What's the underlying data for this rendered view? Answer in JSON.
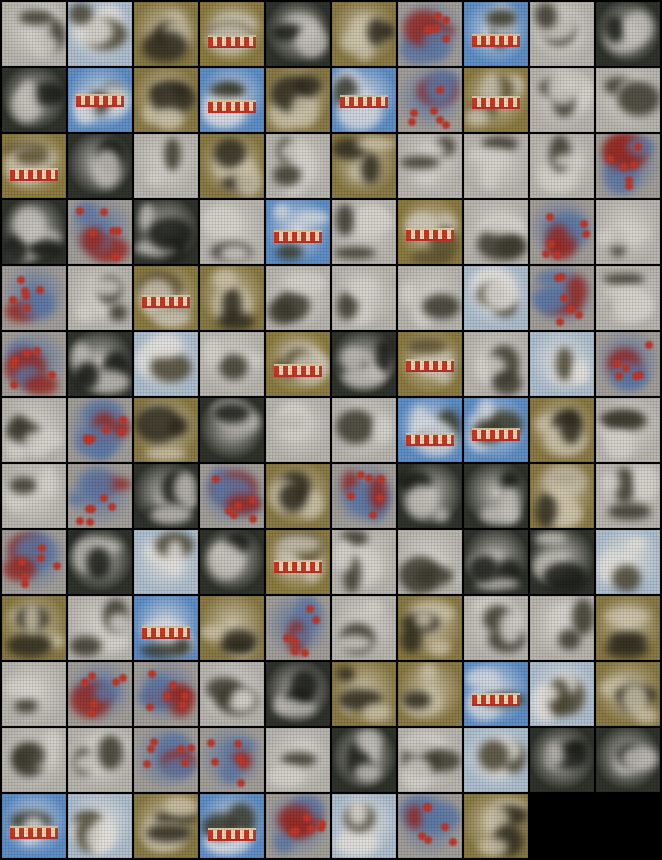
{
  "grid": {
    "columns": 10,
    "total_samples": 128,
    "background_color": "#000000",
    "cells": [
      [
        "gray",
        "sky",
        "olive",
        "boatolive",
        "dark",
        "olive",
        "red",
        "bluesky",
        "gray",
        "dark"
      ],
      [
        "dark",
        "bluesky",
        "olive",
        "bluesky",
        "olive",
        "bluesky",
        "red",
        "boatolive",
        "gray",
        "gray"
      ],
      [
        "boatolive",
        "dark",
        "gray",
        "olive",
        "gray",
        "olive",
        "gray",
        "gray",
        "gray",
        "red"
      ],
      [
        "dark",
        "red",
        "dark",
        "gray",
        "bluesky",
        "gray",
        "boatolive",
        "gray",
        "red",
        "gray"
      ],
      [
        "red",
        "gray",
        "boatolive",
        "olive",
        "gray",
        "gray",
        "gray",
        "sky",
        "red",
        "gray"
      ],
      [
        "red",
        "dark",
        "sky",
        "gray",
        "boatolive",
        "dark",
        "boatolive",
        "gray",
        "sky",
        "red"
      ],
      [
        "gray",
        "red",
        "olive",
        "dark",
        "gray",
        "gray",
        "bluesky",
        "bluesky",
        "olive",
        "gray"
      ],
      [
        "gray",
        "red",
        "dark",
        "red",
        "olive",
        "red",
        "dark",
        "dark",
        "olive",
        "gray"
      ],
      [
        "red",
        "dark",
        "sky",
        "dark",
        "boatolive",
        "gray",
        "gray",
        "dark",
        "dark",
        "sky"
      ],
      [
        "olive",
        "gray",
        "bluesky",
        "olive",
        "red",
        "gray",
        "olive",
        "gray",
        "gray",
        "olive"
      ],
      [
        "gray",
        "red",
        "red",
        "gray",
        "dark",
        "olive",
        "olive",
        "bluesky",
        "sky",
        "olive"
      ],
      [
        "gray",
        "gray",
        "red",
        "red",
        "gray",
        "dark",
        "gray",
        "sky",
        "dark",
        "dark"
      ],
      [
        "bluesky",
        "sky",
        "olive",
        "bluesky",
        "red",
        "sky",
        "red",
        "olive"
      ]
    ]
  },
  "palette": {
    "gray": {
      "bg": "#b9b6b0",
      "blob": "#3d3a2e",
      "accent": "#d8d5cf"
    },
    "sky": {
      "bg": "#aebfcf",
      "blob": "#4b4633",
      "accent": "#e6e3de"
    },
    "olive": {
      "bg": "#8a7a45",
      "blob": "#2e2a1d",
      "accent": "#cfc6ad"
    },
    "boatolive": {
      "bg": "#8d7c41",
      "blob": "#5f5433",
      "accent": "#d0c9b8"
    },
    "dark": {
      "bg": "#2f332b",
      "blob": "#181a15",
      "accent": "#c9c6c0"
    },
    "bluesky": {
      "bg": "#5f8fc7",
      "blob": "#3a3b2d",
      "accent": "#d9dde3"
    },
    "red": {
      "bg": "#a39f9a",
      "blob": "#9b2b24",
      "accent": "#5f7aa7"
    }
  }
}
